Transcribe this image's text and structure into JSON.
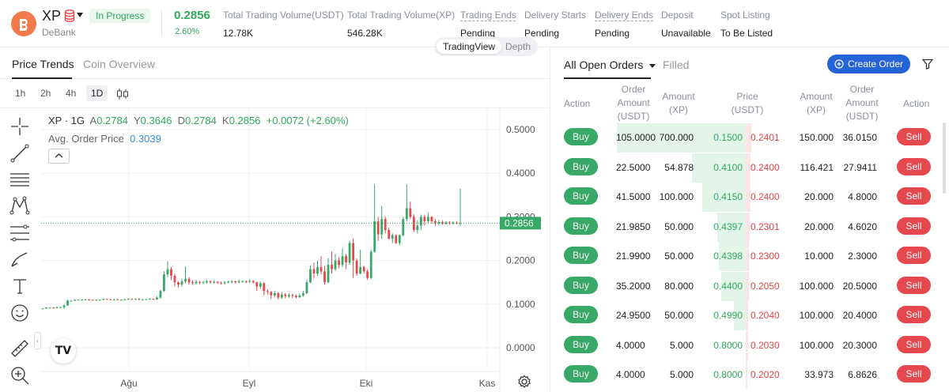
{
  "header": {
    "token": "XP",
    "platform": "DeBank",
    "status": "In Progress",
    "price": "0.2856",
    "change": "2.60%",
    "stats": [
      {
        "label": "Total Trading Volume(USDT)",
        "value": "12.78K",
        "dashed": false
      },
      {
        "label": "Total Trading Volume(XP)",
        "value": "546.28K",
        "dashed": false
      },
      {
        "label": "Trading Ends",
        "value": "Pending",
        "dashed": true
      },
      {
        "label": "Delivery Starts",
        "value": "Pending",
        "dashed": false
      },
      {
        "label": "Delivery Ends",
        "value": "Pending",
        "dashed": true
      },
      {
        "label": "Deposit",
        "value": "Unavailable",
        "dashed": false
      },
      {
        "label": "Spot Listing",
        "value": "To Be Listed",
        "dashed": false
      }
    ]
  },
  "left": {
    "tabs": [
      "Price Trends",
      "Coin Overview"
    ],
    "timeframes": [
      "1h",
      "2h",
      "4h",
      "1D"
    ],
    "active_timeframe": "1D",
    "view_options": [
      "TradingView",
      "Depth"
    ],
    "active_view": "TradingView",
    "legend": {
      "symbol": "XP",
      "interval": "· 1G",
      "o_label": "A",
      "o": "0.2784",
      "h_label": "Y",
      "h": "0.3646",
      "l_label": "D",
      "l": "0.2784",
      "c_label": "K",
      "c": "0.2856",
      "chg": "+0.0072 (+2.60%)"
    },
    "avg_label": "Avg. Order Price",
    "avg_value": "0.3039",
    "tv_logo": "TV"
  },
  "chart_data": {
    "type": "candlestick",
    "y_ticks": [
      "0.5000",
      "0.4000",
      "0.3000",
      "0.2000",
      "0.1000",
      "0.0000"
    ],
    "ylim": [
      0.0,
      0.5
    ],
    "x_ticks": [
      "Ağu",
      "Eyl",
      "Eki",
      "Kas"
    ],
    "last_price_label": "0.2856",
    "last_price": 0.2856,
    "avg_price": 0.3039,
    "grid": true,
    "candles": [
      [
        0.09,
        0.09,
        0.089,
        0.091
      ],
      [
        0.09,
        0.092,
        0.089,
        0.093
      ],
      [
        0.092,
        0.092,
        0.091,
        0.093
      ],
      [
        0.092,
        0.091,
        0.09,
        0.093
      ],
      [
        0.091,
        0.093,
        0.09,
        0.094
      ],
      [
        0.093,
        0.093,
        0.092,
        0.094
      ],
      [
        0.093,
        0.097,
        0.09,
        0.099
      ],
      [
        0.097,
        0.108,
        0.096,
        0.11
      ],
      [
        0.108,
        0.108,
        0.106,
        0.109
      ],
      [
        0.108,
        0.11,
        0.107,
        0.111
      ],
      [
        0.11,
        0.11,
        0.109,
        0.111
      ],
      [
        0.11,
        0.11,
        0.109,
        0.111
      ],
      [
        0.11,
        0.111,
        0.109,
        0.112
      ],
      [
        0.111,
        0.11,
        0.108,
        0.111
      ],
      [
        0.11,
        0.109,
        0.108,
        0.11
      ],
      [
        0.109,
        0.11,
        0.108,
        0.111
      ],
      [
        0.11,
        0.11,
        0.109,
        0.111
      ],
      [
        0.11,
        0.112,
        0.109,
        0.113
      ],
      [
        0.112,
        0.111,
        0.11,
        0.112
      ],
      [
        0.111,
        0.11,
        0.109,
        0.112
      ],
      [
        0.11,
        0.111,
        0.108,
        0.112
      ],
      [
        0.111,
        0.11,
        0.109,
        0.112
      ],
      [
        0.11,
        0.11,
        0.109,
        0.111
      ],
      [
        0.11,
        0.111,
        0.11,
        0.112
      ],
      [
        0.111,
        0.112,
        0.11,
        0.113
      ],
      [
        0.112,
        0.111,
        0.11,
        0.113
      ],
      [
        0.111,
        0.112,
        0.11,
        0.113
      ],
      [
        0.112,
        0.11,
        0.109,
        0.113
      ],
      [
        0.11,
        0.111,
        0.109,
        0.112
      ],
      [
        0.111,
        0.111,
        0.11,
        0.112
      ],
      [
        0.111,
        0.112,
        0.11,
        0.113
      ],
      [
        0.112,
        0.111,
        0.11,
        0.113
      ],
      [
        0.111,
        0.115,
        0.11,
        0.118
      ],
      [
        0.115,
        0.13,
        0.113,
        0.133
      ],
      [
        0.13,
        0.168,
        0.128,
        0.175
      ],
      [
        0.168,
        0.18,
        0.162,
        0.198
      ],
      [
        0.18,
        0.165,
        0.155,
        0.185
      ],
      [
        0.165,
        0.15,
        0.14,
        0.17
      ],
      [
        0.15,
        0.145,
        0.138,
        0.152
      ],
      [
        0.145,
        0.152,
        0.14,
        0.158
      ],
      [
        0.152,
        0.158,
        0.148,
        0.186
      ],
      [
        0.158,
        0.15,
        0.145,
        0.162
      ],
      [
        0.15,
        0.148,
        0.144,
        0.155
      ],
      [
        0.148,
        0.151,
        0.145,
        0.156
      ],
      [
        0.151,
        0.149,
        0.146,
        0.153
      ],
      [
        0.149,
        0.15,
        0.146,
        0.153
      ],
      [
        0.15,
        0.152,
        0.147,
        0.156
      ],
      [
        0.152,
        0.15,
        0.147,
        0.155
      ],
      [
        0.15,
        0.151,
        0.147,
        0.154
      ],
      [
        0.151,
        0.149,
        0.146,
        0.153
      ],
      [
        0.149,
        0.148,
        0.145,
        0.152
      ],
      [
        0.148,
        0.15,
        0.145,
        0.153
      ],
      [
        0.15,
        0.151,
        0.148,
        0.154
      ],
      [
        0.151,
        0.152,
        0.148,
        0.155
      ],
      [
        0.152,
        0.15,
        0.147,
        0.154
      ],
      [
        0.15,
        0.152,
        0.148,
        0.156
      ],
      [
        0.152,
        0.152,
        0.149,
        0.155
      ],
      [
        0.152,
        0.151,
        0.148,
        0.154
      ],
      [
        0.151,
        0.153,
        0.149,
        0.157
      ],
      [
        0.153,
        0.15,
        0.147,
        0.155
      ],
      [
        0.15,
        0.14,
        0.13,
        0.152
      ],
      [
        0.14,
        0.148,
        0.135,
        0.152
      ],
      [
        0.148,
        0.13,
        0.12,
        0.15
      ],
      [
        0.13,
        0.128,
        0.122,
        0.134
      ],
      [
        0.128,
        0.12,
        0.112,
        0.13
      ],
      [
        0.12,
        0.125,
        0.115,
        0.13
      ],
      [
        0.125,
        0.115,
        0.11,
        0.128
      ],
      [
        0.115,
        0.122,
        0.112,
        0.128
      ],
      [
        0.122,
        0.118,
        0.113,
        0.126
      ],
      [
        0.118,
        0.121,
        0.114,
        0.125
      ],
      [
        0.121,
        0.119,
        0.114,
        0.124
      ],
      [
        0.119,
        0.116,
        0.113,
        0.122
      ],
      [
        0.116,
        0.12,
        0.114,
        0.124
      ],
      [
        0.12,
        0.125,
        0.117,
        0.13
      ],
      [
        0.125,
        0.15,
        0.123,
        0.156
      ],
      [
        0.15,
        0.18,
        0.148,
        0.188
      ],
      [
        0.18,
        0.17,
        0.16,
        0.195
      ],
      [
        0.17,
        0.185,
        0.165,
        0.2
      ],
      [
        0.185,
        0.175,
        0.168,
        0.21
      ],
      [
        0.175,
        0.15,
        0.145,
        0.188
      ],
      [
        0.15,
        0.19,
        0.148,
        0.205
      ],
      [
        0.19,
        0.18,
        0.17,
        0.22
      ],
      [
        0.18,
        0.2,
        0.176,
        0.215
      ],
      [
        0.2,
        0.19,
        0.182,
        0.208
      ],
      [
        0.19,
        0.21,
        0.185,
        0.228
      ],
      [
        0.21,
        0.195,
        0.18,
        0.215
      ],
      [
        0.195,
        0.24,
        0.19,
        0.245
      ],
      [
        0.24,
        0.2,
        0.16,
        0.25
      ],
      [
        0.2,
        0.17,
        0.165,
        0.205
      ],
      [
        0.17,
        0.185,
        0.168,
        0.225
      ],
      [
        0.185,
        0.175,
        0.17,
        0.188
      ],
      [
        0.175,
        0.16,
        0.155,
        0.18
      ],
      [
        0.16,
        0.22,
        0.157,
        0.225
      ],
      [
        0.22,
        0.29,
        0.218,
        0.375
      ],
      [
        0.29,
        0.26,
        0.245,
        0.3
      ],
      [
        0.26,
        0.295,
        0.25,
        0.325
      ],
      [
        0.295,
        0.27,
        0.262,
        0.3
      ],
      [
        0.27,
        0.25,
        0.248,
        0.275
      ],
      [
        0.25,
        0.258,
        0.24,
        0.262
      ],
      [
        0.258,
        0.24,
        0.238,
        0.26
      ],
      [
        0.24,
        0.258,
        0.235,
        0.26
      ],
      [
        0.258,
        0.295,
        0.255,
        0.3
      ],
      [
        0.295,
        0.32,
        0.29,
        0.375
      ],
      [
        0.32,
        0.3,
        0.295,
        0.335
      ],
      [
        0.3,
        0.27,
        0.265,
        0.306
      ],
      [
        0.27,
        0.28,
        0.262,
        0.292
      ],
      [
        0.28,
        0.3,
        0.27,
        0.305
      ],
      [
        0.3,
        0.29,
        0.28,
        0.305
      ],
      [
        0.29,
        0.3,
        0.285,
        0.31
      ],
      [
        0.3,
        0.29,
        0.285,
        0.302
      ],
      [
        0.29,
        0.285,
        0.28,
        0.295
      ],
      [
        0.285,
        0.288,
        0.28,
        0.293
      ],
      [
        0.288,
        0.284,
        0.282,
        0.292
      ],
      [
        0.284,
        0.287,
        0.282,
        0.29
      ],
      [
        0.287,
        0.285,
        0.282,
        0.29
      ],
      [
        0.285,
        0.287,
        0.282,
        0.29
      ],
      [
        0.287,
        0.285,
        0.283,
        0.29
      ],
      [
        0.285,
        0.2856,
        0.2784,
        0.3646
      ]
    ]
  },
  "right": {
    "tabs": [
      "All Open Orders",
      "Filled"
    ],
    "create_label": "Create Order",
    "headers": {
      "action_left": "Action",
      "order_amt_l1": "Order",
      "order_amt_l2": "Amount",
      "order_amt_l3": "(USDT)",
      "amount_l1": "Amount",
      "amount_l2": "(XP)",
      "price_l1": "Price",
      "price_l2": "(USDT)",
      "r_amount_l1": "Amount",
      "r_amount_l2": "(XP)",
      "r_order_l1": "Order",
      "r_order_l2": "Amount",
      "r_order_l3": "(USDT)",
      "action_right": "Action"
    },
    "buy_label": "Buy",
    "sell_label": "Sell",
    "rows": [
      {
        "b_usdt": "105.0000",
        "b_xp": "700.000",
        "b_price": "0.1500",
        "a_price": "0.2401",
        "a_xp": "150.000",
        "a_usdt": "36.0150",
        "bid_depth": 1.0,
        "ask_depth": 0.09
      },
      {
        "b_usdt": "22.5000",
        "b_xp": "54.878",
        "b_price": "0.4100",
        "a_price": "0.2400",
        "a_xp": "116.421",
        "a_usdt": "27.9411",
        "bid_depth": 0.42,
        "ask_depth": 0.07
      },
      {
        "b_usdt": "41.5000",
        "b_xp": "100.000",
        "b_price": "0.4150",
        "a_price": "0.2400",
        "a_xp": "20.000",
        "a_usdt": "4.8000",
        "bid_depth": 0.34,
        "ask_depth": 0.07
      },
      {
        "b_usdt": "21.9850",
        "b_xp": "50.000",
        "b_price": "0.4397",
        "a_price": "0.2301",
        "a_xp": "20.000",
        "a_usdt": "4.6020",
        "bid_depth": 0.22,
        "ask_depth": 0.06
      },
      {
        "b_usdt": "21.9900",
        "b_xp": "50.000",
        "b_price": "0.4398",
        "a_price": "0.2300",
        "a_xp": "10.000",
        "a_usdt": "2.3000",
        "bid_depth": 0.21,
        "ask_depth": 0.05
      },
      {
        "b_usdt": "35.2000",
        "b_xp": "80.000",
        "b_price": "0.4400",
        "a_price": "0.2050",
        "a_xp": "100.000",
        "a_usdt": "20.5000",
        "bid_depth": 0.19,
        "ask_depth": 0.05
      },
      {
        "b_usdt": "24.9500",
        "b_xp": "50.000",
        "b_price": "0.4990",
        "a_price": "0.2040",
        "a_xp": "100.000",
        "a_usdt": "20.4000",
        "bid_depth": 0.09,
        "ask_depth": 0.04
      },
      {
        "b_usdt": "4.0000",
        "b_xp": "5.000",
        "b_price": "0.8000",
        "a_price": "0.2030",
        "a_xp": "100.000",
        "a_usdt": "20.3000",
        "bid_depth": 0.0,
        "ask_depth": 0.04
      },
      {
        "b_usdt": "4.0000",
        "b_xp": "5.000",
        "b_price": "0.8000",
        "a_price": "0.2020",
        "a_xp": "33.973",
        "a_usdt": "6.8626",
        "bid_depth": 0.0,
        "ask_depth": 0.03
      }
    ]
  },
  "colors": {
    "up": "#37a866",
    "down": "#e5484d",
    "accent": "#2563d8",
    "brand": "#f07a4a"
  }
}
